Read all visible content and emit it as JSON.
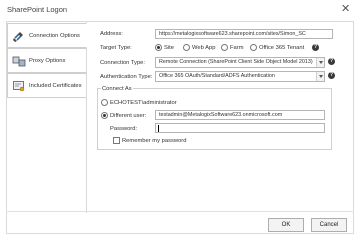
{
  "window": {
    "title": "SharePoint Logon"
  },
  "tabs": [
    {
      "label": "Connection Options",
      "icon": "connection-options-icon"
    },
    {
      "label": "Proxy Options",
      "icon": "proxy-options-icon"
    },
    {
      "label": "Included Certificates",
      "icon": "certificates-icon"
    }
  ],
  "form": {
    "address_label": "Address:",
    "address_value": "https://metalogixsoftware623.sharepoint.com/sites/Simon_SC",
    "target_type_label": "Target Type:",
    "target_types": [
      "Site",
      "Web App",
      "Farm",
      "Office 365 Tenant"
    ],
    "connection_type_label": "Connection Type:",
    "connection_type_value": "Remote Connection (SharePoint Client Side Object Model 2013)",
    "auth_type_label": "Authentication Type:",
    "auth_type_value": "Office 365 OAuth/Standard/ADFS Authentication"
  },
  "connect_as": {
    "group_label": "Connect As",
    "current_user": "ECHOTEST\\administrator",
    "different_user_label": "Different user:",
    "username_value": "testadmin@MetalogixSoftware623.onmicrosoft.com",
    "password_label": "Password:",
    "password_value": "",
    "remember_label": "Remember my password"
  },
  "buttons": {
    "ok": "OK",
    "cancel": "Cancel"
  }
}
